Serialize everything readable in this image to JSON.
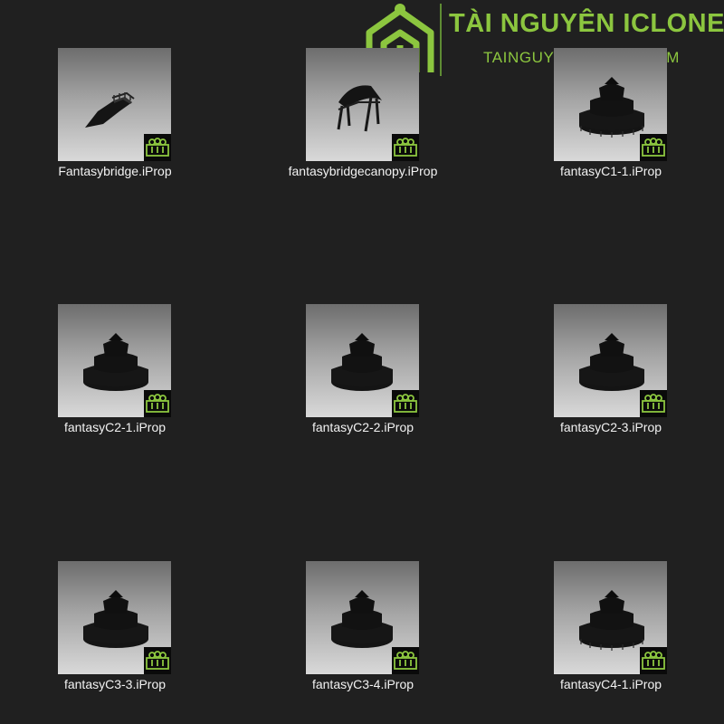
{
  "watermark": {
    "title": "TÀI NGUYÊN ICLONE",
    "subtitle": "TAINGUYENICLONE.COM",
    "color": "#8cc63f"
  },
  "badge_icon": "iclone-prop-icon",
  "files": [
    {
      "name": "Fantasybridge.iProp",
      "model": "bridge"
    },
    {
      "name": "fantasybridgecanopy.iProp",
      "model": "canopy"
    },
    {
      "name": "fantasyC1-1.iProp",
      "model": "castle"
    },
    {
      "name": "fantasyC2-1.iProp",
      "model": "castle"
    },
    {
      "name": "fantasyC2-2.iProp",
      "model": "castle"
    },
    {
      "name": "fantasyC2-3.iProp",
      "model": "castle"
    },
    {
      "name": "fantasyC3-3.iProp",
      "model": "castle"
    },
    {
      "name": "fantasyC3-4.iProp",
      "model": "castle"
    },
    {
      "name": "fantasyC4-1.iProp",
      "model": "castle"
    }
  ]
}
